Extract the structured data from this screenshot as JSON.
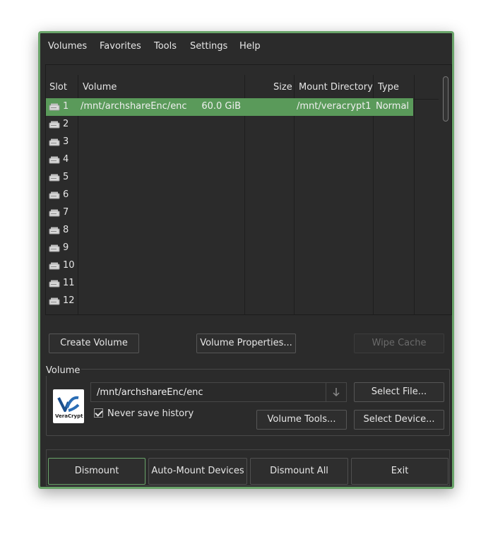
{
  "menu": [
    "Volumes",
    "Favorites",
    "Tools",
    "Settings",
    "Help"
  ],
  "columns": {
    "slot": "Slot",
    "volume": "Volume",
    "size": "Size",
    "mount_dir": "Mount Directory",
    "type": "Type"
  },
  "slots": [
    {
      "slot": "1",
      "volume": "/mnt/archshareEnc/enc",
      "size": "60.0 GiB",
      "mount_dir": "/mnt/veracrypt1",
      "type": "Normal",
      "selected": true
    },
    {
      "slot": "2"
    },
    {
      "slot": "3"
    },
    {
      "slot": "4"
    },
    {
      "slot": "5"
    },
    {
      "slot": "6"
    },
    {
      "slot": "7"
    },
    {
      "slot": "8"
    },
    {
      "slot": "9"
    },
    {
      "slot": "10"
    },
    {
      "slot": "11"
    },
    {
      "slot": "12"
    }
  ],
  "buttons": {
    "create_volume": "Create Volume",
    "volume_properties": "Volume Properties...",
    "wipe_cache": "Wipe Cache",
    "select_file": "Select File...",
    "volume_tools": "Volume Tools...",
    "select_device": "Select Device...",
    "dismount": "Dismount",
    "auto_mount": "Auto-Mount Devices",
    "dismount_all": "Dismount All",
    "exit": "Exit"
  },
  "volume_group": {
    "label": "Volume",
    "path_value": "/mnt/archshareEnc/enc",
    "never_save_history": "Never save history",
    "never_save_history_checked": true,
    "logo_text": "VeraCrypt"
  },
  "colors": {
    "accent": "#6aa56a",
    "selection": "#5a9a5a",
    "window_bg": "#2b2b2b"
  }
}
